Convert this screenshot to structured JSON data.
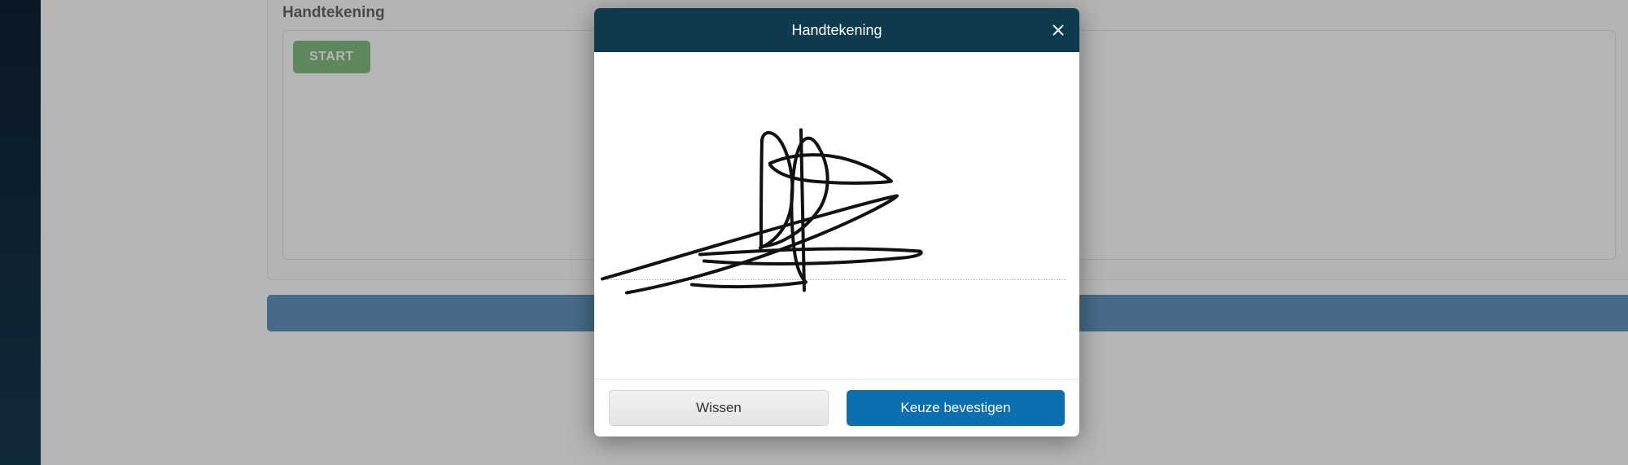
{
  "page": {
    "signature_label": "Handtekening",
    "start_button": "START"
  },
  "modal": {
    "title": "Handtekening",
    "clear_button": "Wissen",
    "confirm_button": "Keuze bevestigen"
  }
}
